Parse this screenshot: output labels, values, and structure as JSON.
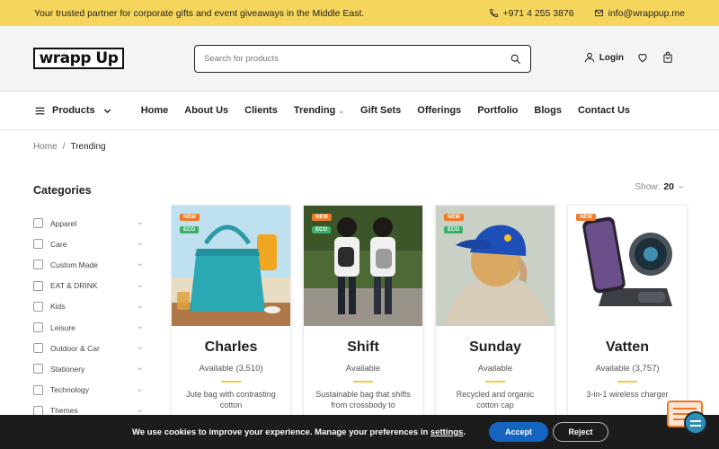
{
  "topbar": {
    "tagline": "Your trusted partner for corporate gifts and event giveaways in the Middle East.",
    "phone": "+971 4 255 3876",
    "email": "info@wrappup.me"
  },
  "header": {
    "logo_text": "wrapp Up",
    "search_placeholder": "Search for products",
    "login_label": "Login"
  },
  "nav": {
    "products_label": "Products",
    "links": [
      "Home",
      "About Us",
      "Clients",
      "Trending",
      "Gift Sets",
      "Offerings",
      "Portfolio",
      "Blogs",
      "Contact Us"
    ]
  },
  "breadcrumb": {
    "home": "Home",
    "separator": "/",
    "current": "Trending"
  },
  "sidebar": {
    "title": "Categories",
    "categories": [
      "Apparel",
      "Care",
      "Custom Made",
      "EAT & DRINK",
      "Kids",
      "Leisure",
      "Outdoor & Car",
      "Stationery",
      "Technology",
      "Themes"
    ]
  },
  "listing": {
    "show_label": "Show:",
    "show_value": "20"
  },
  "products": [
    {
      "name": "Charles",
      "availability": "Available (3,510)",
      "description": "Jute bag with contrasting cotton",
      "badge_new": "NEW",
      "badge_eco": "ECO"
    },
    {
      "name": "Shift",
      "availability": "Available",
      "description": "Sustainable bag that shifts from crossbody to",
      "badge_new": "NEW",
      "badge_eco": "ECO"
    },
    {
      "name": "Sunday",
      "availability": "Available",
      "description": "Recycled and organic cotton cap",
      "badge_new": "NEW",
      "badge_eco": "ECO"
    },
    {
      "name": "Vatten",
      "availability": "Available (3,757)",
      "description": "3-in-1 wireless charger",
      "badge_new": "NEW"
    }
  ],
  "cookie": {
    "message": "We use cookies to improve your experience. Manage your preferences in",
    "settings_link": "settings",
    "accept_label": "Accept",
    "reject_label": "Reject"
  },
  "colors": {
    "topbar_bg": "#f6d55c",
    "new_badge": "#f07a2a",
    "eco_badge": "#3bb06b",
    "accept_button": "#1565c0",
    "cookie_bar": "#1c1c1c"
  }
}
